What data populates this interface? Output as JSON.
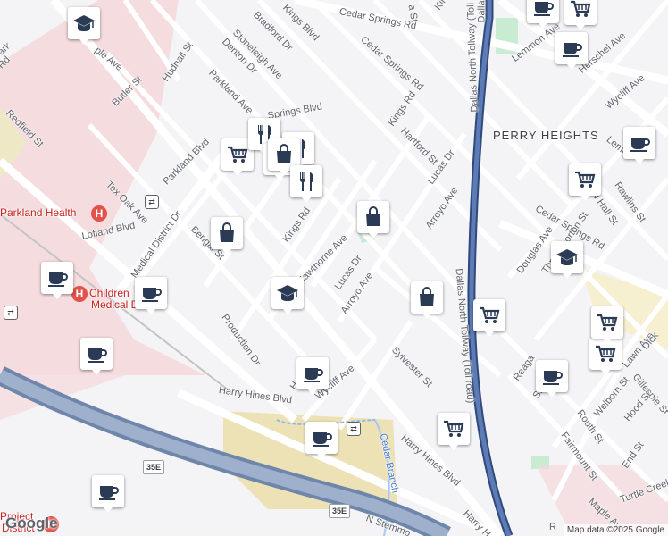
{
  "map": {
    "attribution": "Map data ©2025 Google",
    "logo_text": "Google",
    "neighborhood": "PERRY HEIGHTS",
    "hospitals": {
      "parkland": "Parkland Health",
      "childrens_line1": "Children",
      "childrens_line2": "Medical Dallas"
    },
    "highway_shield": "35E",
    "creek": "Cedar Branch",
    "streets": {
      "cedar_springs_rd_top": "Cedar Springs Rd",
      "cedar_springs_rd_right": "Cedar Springs Rd",
      "maple_ave_top": "Maple Ave",
      "maple_ave_bottom": "Maple Ave",
      "lemmon_ave": "Lemmon Ave",
      "lemmon_ave_2": "Lemm",
      "herschel_ave": "Herschel Ave",
      "wycliff_ave_top": "Wycliff Ave",
      "wycliff_ave_bottom": "Wycliff Ave",
      "butler_st": "Butler St",
      "hudnall_st": "Hudnall St",
      "denton_dr": "Denton Dr",
      "bradford_dr": "Bradford Dr",
      "stoneleigh_ave": "Stoneleigh Ave",
      "kings_blvd": "Kings Blvd",
      "kings_rd_top": "Kings Rd",
      "kings_rd_mid": "Kings Rd",
      "springs_blvd": "Springs Blvd",
      "redfield_st": "Redfield St",
      "parkland_ave": "Parkland Ave",
      "parkland_blvd": "Parkland Blvd",
      "tex_oak_ave": "Tex Oak Ave",
      "lofland_blvd": "Lofland Blvd",
      "medical_district_dr": "Medical District Dr",
      "bengal_st": "Bengal St",
      "hartford_st": "Hartford St",
      "lucas_dr_top": "Lucas Dr",
      "lucas_dr_mid": "Lucas Dr",
      "arroyo_ave_top": "Arroyo Ave",
      "arroyo_ave_mid": "Arroyo Ave",
      "hawthorne_ave": "Hawthorne Ave",
      "production_dr": "Production Dr",
      "harry_hines_blvd_1": "Harry Hines Blvd",
      "harry_hines_blvd_2": "Harry Hines Blvd",
      "harry_hines_blvd_3": "Harry H",
      "sylvester_st": "Sylvester St",
      "dallas_tollway_1": "Dallas North Tollway (Toll road)",
      "dallas_tollway_2": "Dallas North Tollway (Toll road)",
      "dallas_tollway_top": "Dallas",
      "douglas_ave": "Douglas Ave",
      "rawlins_st": "Rawlins St",
      "n_hall_st": "N Hall St",
      "throckmorton_st": "Throckmorton St",
      "reagan_st": "Reaga",
      "lawn_ave": "Lawn Ave",
      "dickason": "Dick",
      "gillespie_st": "Gillespie St",
      "routh_st": "Routh St",
      "welborn_st": "Welborn St",
      "hood_st": "Hood St",
      "fairmount_st": "Fairmount St",
      "end_st": "End St",
      "turtle_creek": "Turtle Creek",
      "n_stemmons": "N Stemmo",
      "sh_st": "She",
      "ho_st": "Ho",
      "red_st": "Rd",
      "ark_st": "ark",
      "ple_ave": "ple Ave",
      "r_bottom": "R",
      "hospital_district": "District",
      "hospital_project": "Project",
      "oak_lawn_top": "a St",
      "kings_st_top": "Kings"
    },
    "markers": [
      {
        "type": "school",
        "name": "school-marker-1"
      },
      {
        "type": "coffee",
        "name": "coffee-marker-1"
      },
      {
        "type": "shopping",
        "name": "shopping-marker-1"
      },
      {
        "type": "restaurant",
        "name": "restaurant-marker-1"
      },
      {
        "type": "shopping",
        "name": "shopping-marker-2"
      },
      {
        "type": "restaurant",
        "name": "restaurant-marker-2"
      },
      {
        "type": "shop",
        "name": "shopping-marker-3"
      },
      {
        "type": "coffee",
        "name": "coffee-marker-2"
      },
      {
        "type": "coffee",
        "name": "coffee-marker-3"
      },
      {
        "type": "shopping",
        "name": "shopping-marker-4"
      },
      {
        "type": "shop",
        "name": "bag-marker-1"
      },
      {
        "type": "shop",
        "name": "bag-marker-2"
      },
      {
        "type": "shop",
        "name": "bag-marker-3"
      },
      {
        "type": "restaurant",
        "name": "restaurant-marker-3"
      },
      {
        "type": "school",
        "name": "school-marker-2"
      },
      {
        "type": "school",
        "name": "school-marker-3"
      },
      {
        "type": "coffee",
        "name": "coffee-marker-4"
      },
      {
        "type": "coffee",
        "name": "coffee-marker-5"
      },
      {
        "type": "shopping",
        "name": "shopping-marker-5"
      },
      {
        "type": "shopping",
        "name": "shopping-marker-6"
      },
      {
        "type": "coffee",
        "name": "coffee-marker-6"
      },
      {
        "type": "coffee",
        "name": "coffee-marker-7"
      },
      {
        "type": "coffee",
        "name": "coffee-marker-8"
      },
      {
        "type": "shopping",
        "name": "shopping-marker-7"
      },
      {
        "type": "shopping",
        "name": "shopping-marker-8"
      },
      {
        "type": "shopping",
        "name": "shopping-marker-9"
      },
      {
        "type": "coffee",
        "name": "coffee-marker-9"
      },
      {
        "type": "coffee",
        "name": "coffee-marker-10"
      }
    ],
    "colors": {
      "background": "#f4f3f6",
      "hospital_area": "#f5d6d8",
      "highway": "#7f93b0",
      "tollway": "#4a6aa0",
      "park": "#c9ebd2",
      "sand": "#ece2b6",
      "marker_icon": "#2b3a55"
    }
  }
}
